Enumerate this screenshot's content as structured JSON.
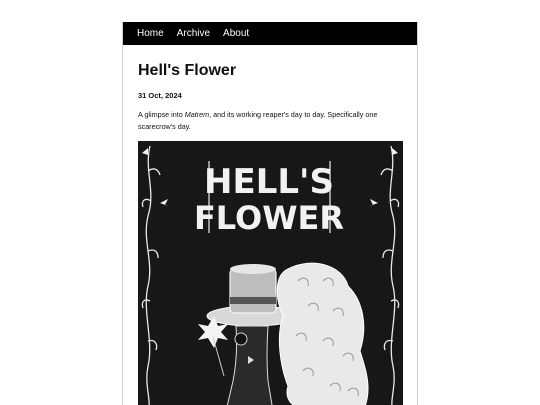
{
  "nav": {
    "items": [
      {
        "label": "Home"
      },
      {
        "label": "Archive"
      },
      {
        "label": "About"
      }
    ]
  },
  "post": {
    "title": "Hell's Flower",
    "date": "31 Oct, 2024",
    "body_before": "A glimpse into ",
    "body_em": "Matrem",
    "body_after": ", and its working reaper's day to day. Specifically one scarecrow's day."
  },
  "cover": {
    "title_line1": "HELL'S",
    "title_line2": "FLOWER",
    "background": "#151515",
    "ink": "#f2f2f2"
  }
}
